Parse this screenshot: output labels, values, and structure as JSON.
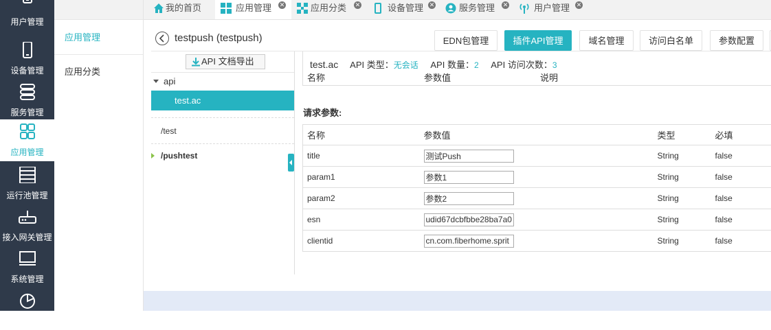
{
  "sidebar": {
    "items": [
      {
        "label": "用户管理",
        "icon": "phone-icon"
      },
      {
        "label": "设备管理",
        "icon": "mobile-icon"
      },
      {
        "label": "服务管理",
        "icon": "server-stack-icon"
      },
      {
        "label": "应用管理",
        "icon": "grid-apps-icon"
      },
      {
        "label": "运行池管理",
        "icon": "rack-icon"
      },
      {
        "label": "接入网关管理",
        "icon": "router-icon"
      },
      {
        "label": "系统管理",
        "icon": "monitor-icon"
      },
      {
        "label": "",
        "icon": "pie-chart-icon"
      }
    ],
    "active_color": "#26b3c1",
    "background": "#2f3a4a"
  },
  "subnav": {
    "items": [
      {
        "label": "应用管理"
      },
      {
        "label": "应用分类"
      }
    ]
  },
  "tabs": [
    {
      "label": "我的首页",
      "icon": "home-icon"
    },
    {
      "label": "应用管理",
      "icon": "grid-icon"
    },
    {
      "label": "应用分类",
      "icon": "category-icon"
    },
    {
      "label": "设备管理",
      "icon": "mobile-icon"
    },
    {
      "label": "服务管理",
      "icon": "user-circle-icon"
    },
    {
      "label": "用户管理",
      "icon": "signal-icon"
    }
  ],
  "header": {
    "title": "testpush (testpush)"
  },
  "function_tabs": [
    {
      "label": "EDN包管理"
    },
    {
      "label": "插件API管理"
    },
    {
      "label": "域名管理"
    },
    {
      "label": "访问白名单"
    },
    {
      "label": "参数配置"
    }
  ],
  "tree": {
    "export_label": "API 文档导出",
    "root_label": "api",
    "selected_label": "test.ac",
    "nodes": [
      {
        "label": "/test"
      },
      {
        "label": "/pushtest"
      }
    ]
  },
  "api_info": {
    "name": "test.ac",
    "type_label": "API 类型：",
    "type_value": "无会话",
    "count_label": "API 数量：",
    "count_value": "2",
    "visits_label": "API 访问次数：",
    "visits_value": "3"
  },
  "response_table": {
    "headers": [
      "名称",
      "参数值",
      "说明"
    ]
  },
  "request_params": {
    "title": "请求参数:",
    "headers": [
      "名称",
      "参数值",
      "类型",
      "必填"
    ],
    "rows": [
      {
        "name": "title",
        "value": "测试Push",
        "type": "String",
        "required": "false"
      },
      {
        "name": "param1",
        "value": "参数1",
        "type": "String",
        "required": "false"
      },
      {
        "name": "param2",
        "value": "参数2",
        "type": "String",
        "required": "false"
      },
      {
        "name": "esn",
        "value": "udid67dcbfbbe28ba7a0",
        "type": "String",
        "required": "false"
      },
      {
        "name": "clientid",
        "value": "cn.com.fiberhome.sprit",
        "type": "String",
        "required": "false"
      }
    ]
  }
}
